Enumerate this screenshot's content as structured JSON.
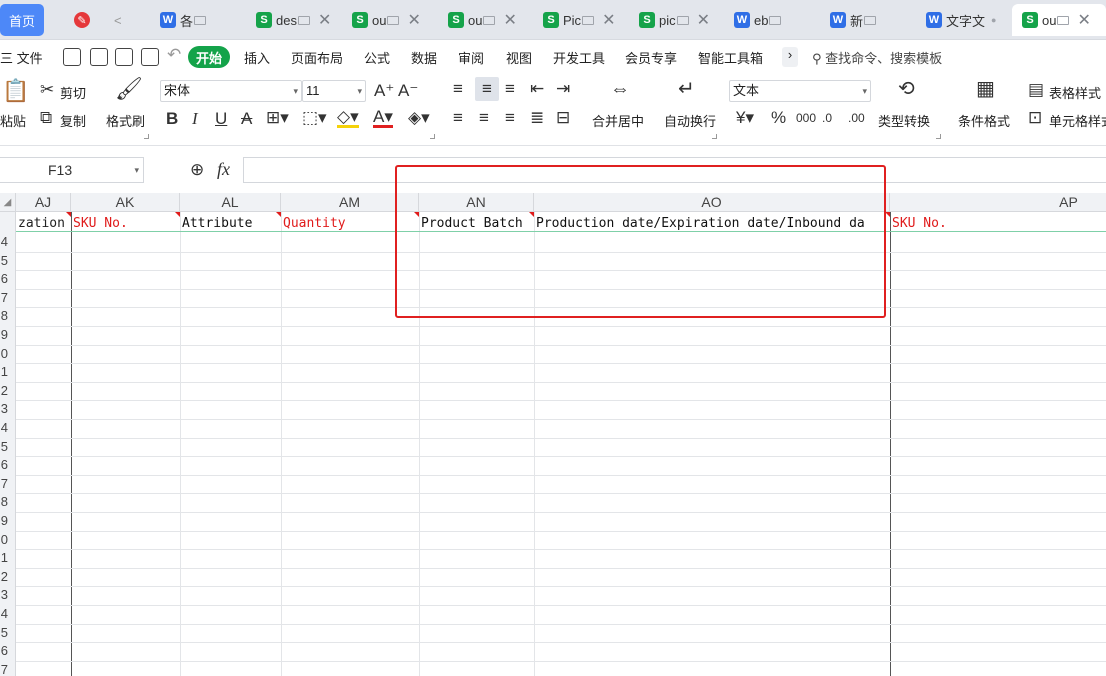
{
  "tabs": [
    {
      "label": "首页",
      "type": "home"
    },
    {
      "label": "",
      "type": "pdf"
    },
    {
      "label": "< ",
      "type": "nav"
    },
    {
      "label": "各",
      "type": "w"
    },
    {
      "label": "des",
      "type": "s"
    },
    {
      "label": "ou",
      "type": "s"
    },
    {
      "label": "ou",
      "type": "s"
    },
    {
      "label": "Pic",
      "type": "s"
    },
    {
      "label": "pic",
      "type": "s"
    },
    {
      "label": "eb",
      "type": "w"
    },
    {
      "label": "新",
      "type": "w"
    },
    {
      "label": "文字文",
      "type": "w"
    },
    {
      "label": "ou",
      "type": "s"
    }
  ],
  "menu": {
    "file": "三 文件",
    "start": "开始",
    "items": [
      "插入",
      "页面布局",
      "公式",
      "数据",
      "审阅",
      "视图",
      "开发工具",
      "会员专享",
      "智能工具箱"
    ],
    "more": "›",
    "search_placeholder": "查找命令、搜索模板"
  },
  "ribbon": {
    "paste": "粘贴",
    "cut": "剪切",
    "copy": "复制",
    "format_painter": "格式刷",
    "font_name": "宋体",
    "font_size": "11",
    "merge_center": "合并居中",
    "wrap_text": "自动换行",
    "number_format": "文本",
    "type_convert": "类型转换",
    "conditional_format": "条件格式",
    "table_style": "表格样式",
    "cell_style": "单元格样式"
  },
  "formula_bar": {
    "cell_ref": "F13",
    "fx_label": "fx",
    "value": ""
  },
  "grid": {
    "columns": [
      "AJ",
      "AK",
      "AL",
      "AM",
      "AN",
      "AO",
      "AP"
    ],
    "header_cells": [
      {
        "text": "zation",
        "color": "black"
      },
      {
        "text": "SKU No.",
        "color": "red"
      },
      {
        "text": "Attribute",
        "color": "black"
      },
      {
        "text": "Quantity",
        "color": "red"
      },
      {
        "text": "Product Batch",
        "color": "black"
      },
      {
        "text": "Production date/Expiration date/Inbound da",
        "color": "black"
      },
      {
        "text": "SKU No.",
        "color": "red"
      }
    ],
    "row_numbers": [
      "4",
      "5",
      "6",
      "7",
      "8",
      "9",
      "0",
      "1",
      "2",
      "3",
      "4",
      "5",
      "6",
      "7",
      "8",
      "9",
      "0",
      "1",
      "2",
      "3",
      "4",
      "5",
      "6",
      "7"
    ]
  },
  "colors": {
    "accent_blue": "#4d88f8",
    "start_green": "#14a34a",
    "highlight_red": "#e02020",
    "header_red_text": "#e01b1b"
  }
}
